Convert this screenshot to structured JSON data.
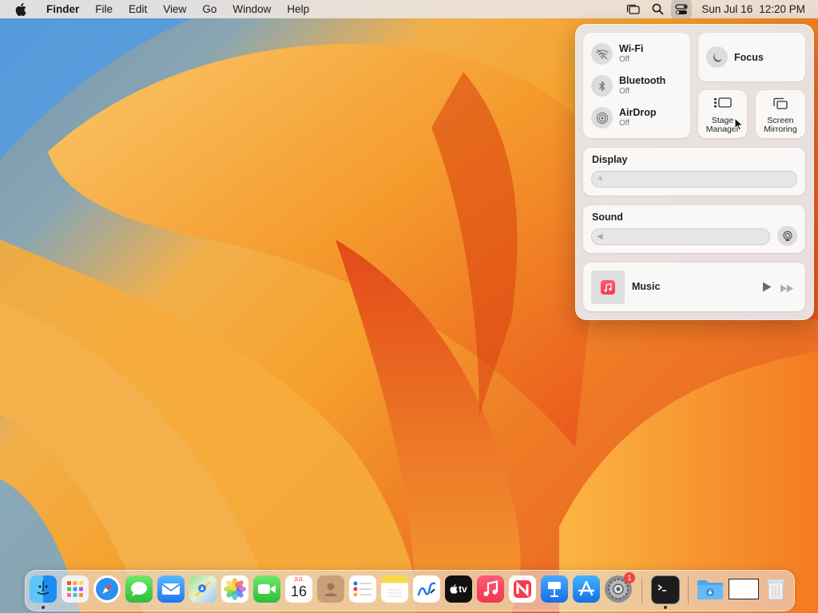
{
  "menubar": {
    "app_name": "Finder",
    "items": [
      "File",
      "Edit",
      "View",
      "Go",
      "Window",
      "Help"
    ],
    "status_icons": [
      "stage-manager-icon",
      "spotlight-search-icon",
      "control-center-icon"
    ],
    "date": "Sun Jul 16",
    "time": "12:20 PM"
  },
  "control_center": {
    "network": [
      {
        "name": "Wi-Fi",
        "status": "Off",
        "icon": "wifi-icon"
      },
      {
        "name": "Bluetooth",
        "status": "Off",
        "icon": "bluetooth-icon"
      },
      {
        "name": "AirDrop",
        "status": "Off",
        "icon": "airdrop-icon"
      }
    ],
    "focus_label": "Focus",
    "stage_manager_line1": "Stage",
    "stage_manager_line2": "Manager",
    "screen_mirroring_line1": "Screen",
    "screen_mirroring_line2": "Mirroring",
    "display_label": "Display",
    "sound_label": "Sound",
    "music_label": "Music"
  },
  "dock": {
    "apps": [
      "Finder",
      "Launchpad",
      "Safari",
      "Messages",
      "Mail",
      "Maps",
      "Photos",
      "FaceTime",
      "Calendar",
      "Contacts",
      "Reminders",
      "Notes",
      "Freeform",
      "TV",
      "Music",
      "News",
      "Keynote",
      "App Store",
      "System Settings",
      "Terminal",
      "Downloads",
      "Window",
      "Trash"
    ],
    "calendar_month": "JUL",
    "calendar_day": "16",
    "tv_label": "tv",
    "settings_badge": "1"
  },
  "colors": {
    "menubar": "#ece4de",
    "accent_orange": "#f08a2a",
    "badge_red": "#f1453d"
  }
}
